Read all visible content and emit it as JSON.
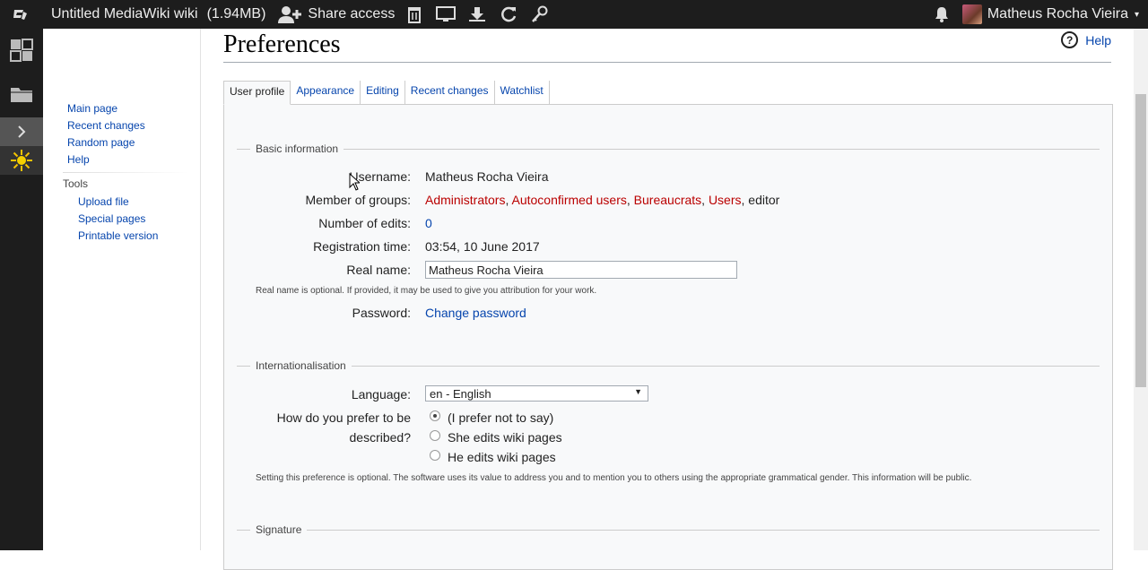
{
  "topbar": {
    "title": "Untitled MediaWiki wiki",
    "size": "(1.94MB)",
    "share": "Share access",
    "username": "Matheus Rocha Vieira",
    "caret": "▾"
  },
  "dock": {
    "icons": [
      "widgets-icon",
      "folder-icon",
      "chevron-right-icon",
      "sun-icon"
    ]
  },
  "sidebar": {
    "links": [
      "Main page",
      "Recent changes",
      "Random page",
      "Help"
    ],
    "tools_heading": "Tools",
    "tools": [
      "Upload file",
      "Special pages",
      "Printable version"
    ]
  },
  "page": {
    "title": "Preferences",
    "help": "Help",
    "tabs": [
      "User profile",
      "Appearance",
      "Editing",
      "Recent changes",
      "Watchlist"
    ]
  },
  "basic": {
    "legend": "Basic information",
    "username_label": "Username:",
    "username_value": "Matheus Rocha Vieira",
    "groups_label": "Member of groups:",
    "groups": [
      "Administrators",
      "Autoconfirmed users",
      "Bureaucrats",
      "Users"
    ],
    "groups_tail": "editor",
    "edits_label": "Number of edits:",
    "edits_value": "0",
    "regtime_label": "Registration time:",
    "regtime_value": "03:54, 10 June 2017",
    "realname_label": "Real name:",
    "realname_value": "Matheus Rocha Vieira",
    "realname_note": "Real name is optional. If provided, it may be used to give you attribution for your work.",
    "password_label": "Password:",
    "password_link": "Change password"
  },
  "intl": {
    "legend": "Internationalisation",
    "language_label": "Language:",
    "language_value": "en - English",
    "gender_label_1": "How do you prefer to be",
    "gender_label_2": "described?",
    "gender_options": [
      "(I prefer not to say)",
      "She edits wiki pages",
      "He edits wiki pages"
    ],
    "gender_selected": 0,
    "gender_note": "Setting this preference is optional. The software uses its value to address you and to mention you to others using the appropriate grammatical gender. This information will be public."
  },
  "signature": {
    "legend": "Signature"
  }
}
